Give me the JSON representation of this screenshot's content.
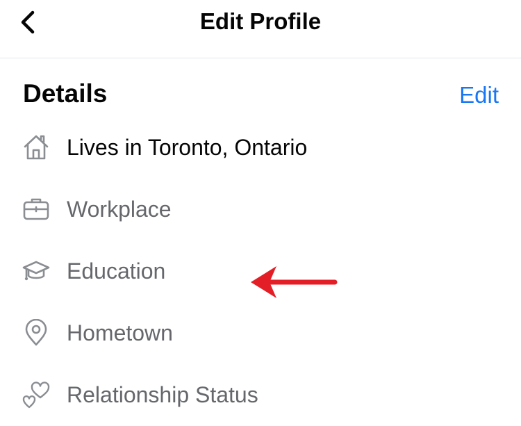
{
  "header": {
    "title": "Edit Profile"
  },
  "details": {
    "title": "Details",
    "edit_label": "Edit",
    "items": [
      {
        "label": "Lives in Toronto, Ontario",
        "icon": "home-icon",
        "filled": true
      },
      {
        "label": "Workplace",
        "icon": "briefcase-icon",
        "filled": false
      },
      {
        "label": "Education",
        "icon": "graduation-cap-icon",
        "filled": false
      },
      {
        "label": "Hometown",
        "icon": "location-pin-icon",
        "filled": false
      },
      {
        "label": "Relationship Status",
        "icon": "hearts-icon",
        "filled": false
      }
    ]
  },
  "colors": {
    "accent": "#1877f2",
    "text_primary": "#050505",
    "text_secondary": "#65676b",
    "annotation_arrow": "#e41e26"
  }
}
